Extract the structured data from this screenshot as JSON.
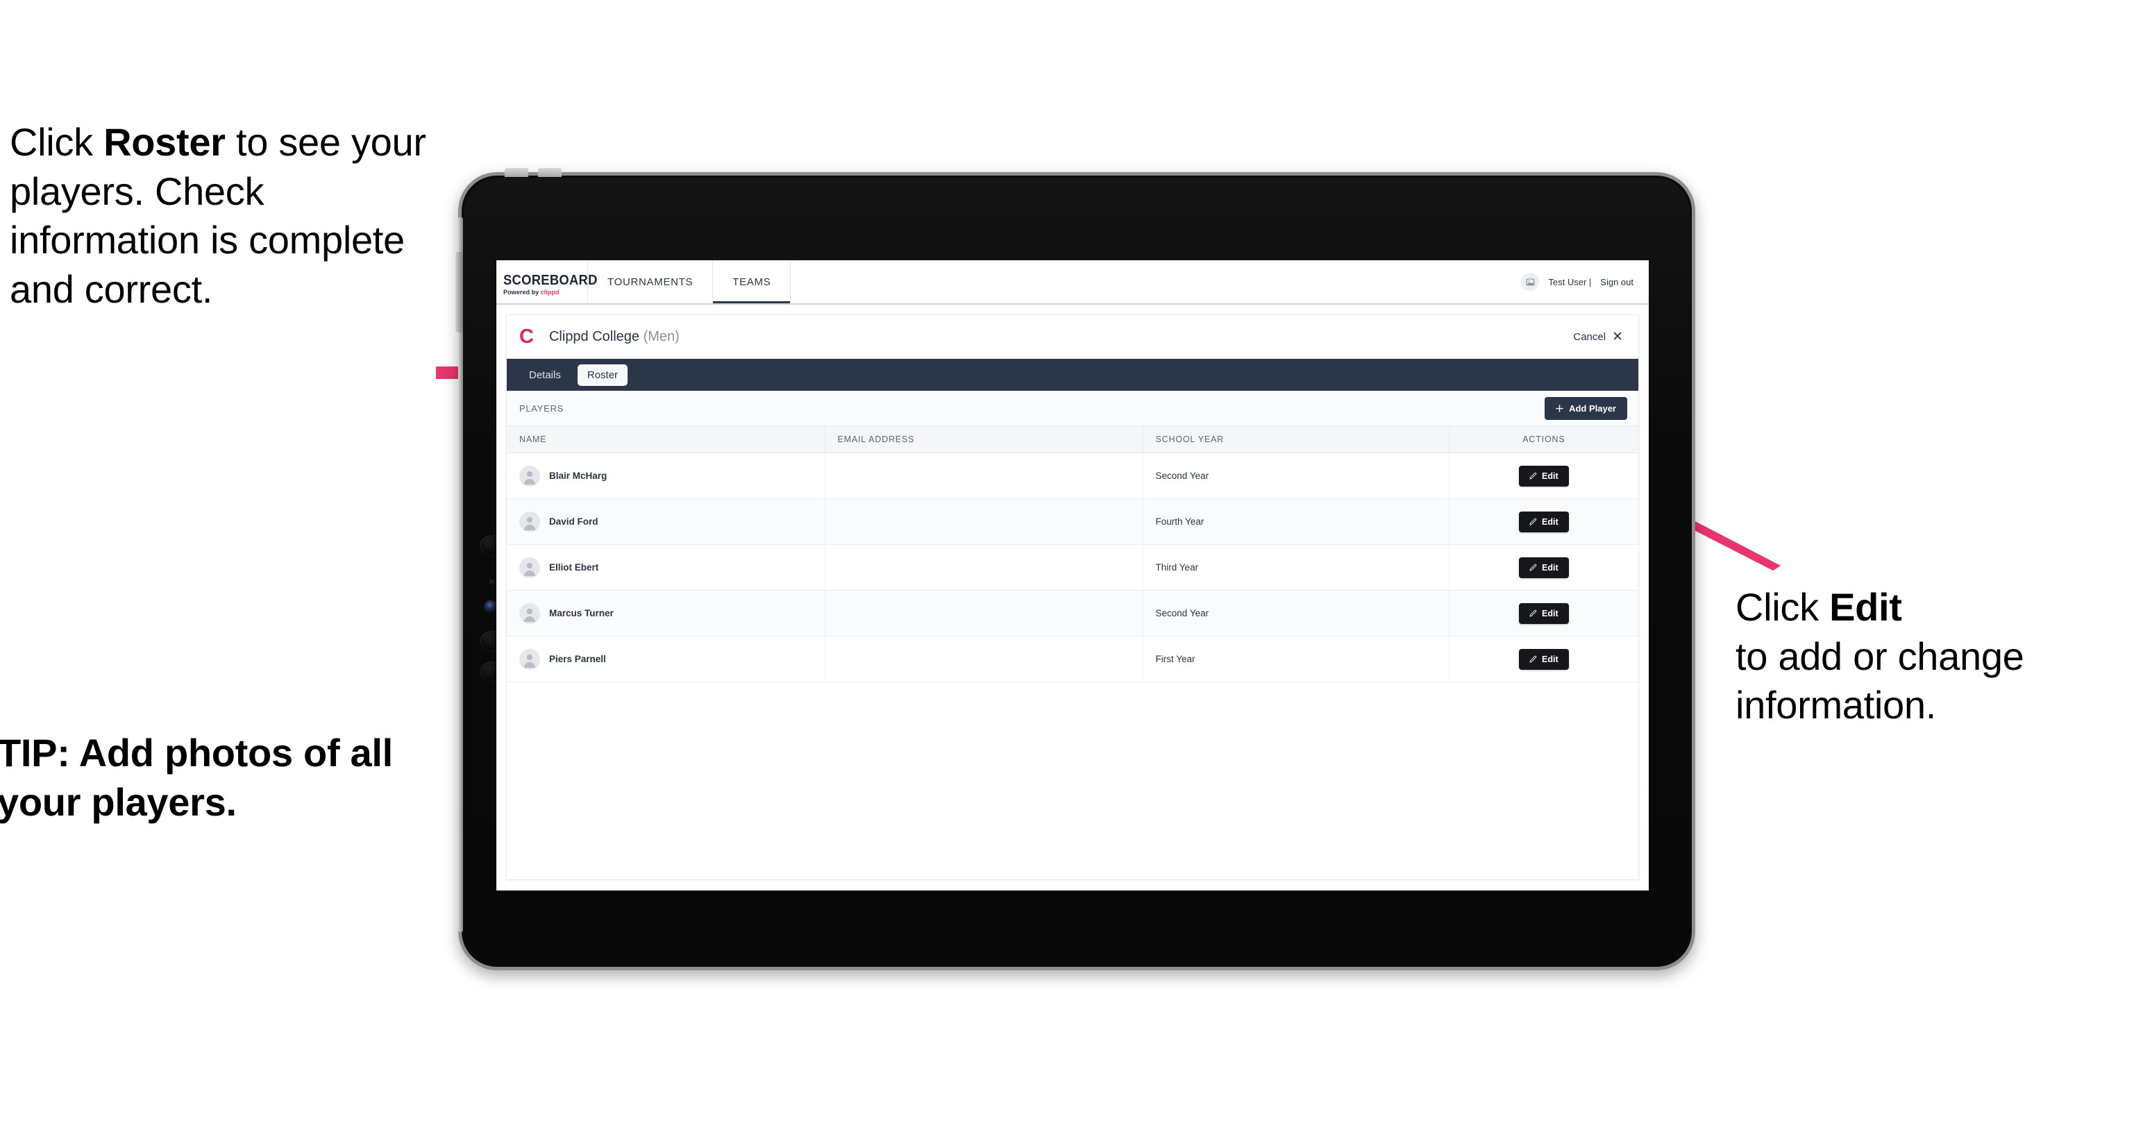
{
  "annotations": {
    "left": {
      "line1_pre": "Click ",
      "line1_bold": "Roster",
      "line1_post": " to",
      "rest": "see your players. Check information is complete and correct."
    },
    "tip": "TIP: Add photos of all your players.",
    "right": {
      "line1_pre": "Click ",
      "line1_bold": "Edit",
      "rest": "to add or change information."
    },
    "arrow_color": "#e8356d"
  },
  "app": {
    "brand": {
      "name": "SCOREBOARD",
      "powered_by": "Powered by ",
      "powered_brand": "clippd"
    },
    "nav": [
      {
        "label": "TOURNAMENTS",
        "active": false
      },
      {
        "label": "TEAMS",
        "active": true
      }
    ],
    "user": {
      "name": "Test User |",
      "sign_out": "Sign out",
      "avatar_icon": "user-image-icon"
    },
    "team": {
      "logo_letter": "C",
      "name": "Clippd College",
      "gender": "(Men)",
      "cancel_label": "Cancel",
      "cancel_icon": "close-x-icon"
    },
    "subtabs": [
      {
        "label": "Details",
        "active": false
      },
      {
        "label": "Roster",
        "active": true
      }
    ],
    "toolbar": {
      "section_label": "PLAYERS",
      "add_player_label": "Add Player",
      "add_player_icon": "plus-icon"
    },
    "table": {
      "columns": [
        "NAME",
        "EMAIL ADDRESS",
        "SCHOOL YEAR",
        "ACTIONS"
      ],
      "edit_label": "Edit",
      "edit_icon": "pencil-icon",
      "rows": [
        {
          "name": "Blair McHarg",
          "email": "",
          "school_year": "Second Year"
        },
        {
          "name": "David Ford",
          "email": "",
          "school_year": "Fourth Year"
        },
        {
          "name": "Elliot Ebert",
          "email": "",
          "school_year": "Third Year"
        },
        {
          "name": "Marcus Turner",
          "email": "",
          "school_year": "Second Year"
        },
        {
          "name": "Piers Parnell",
          "email": "",
          "school_year": "First Year"
        }
      ]
    },
    "colors": {
      "navy": "#2b3648",
      "pink": "#e0245e",
      "dark_button": "#15171a"
    }
  }
}
